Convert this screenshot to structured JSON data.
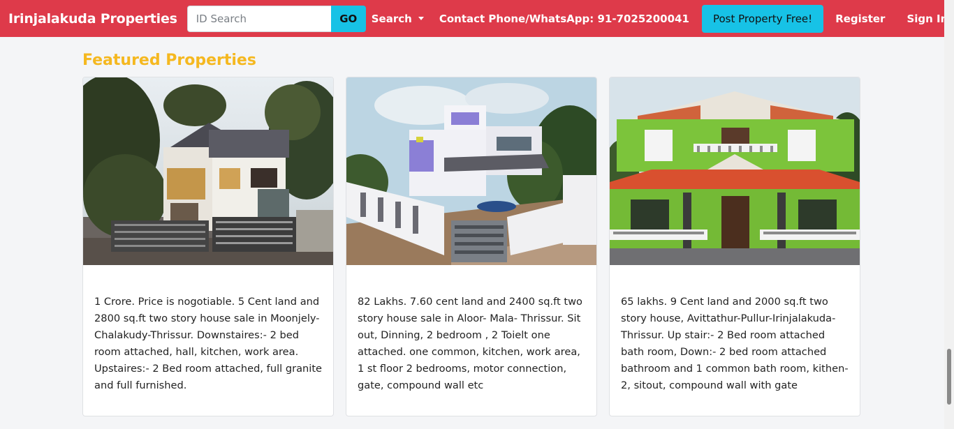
{
  "navbar": {
    "brand": "Irinjalakuda Properties",
    "search_placeholder": "ID Search",
    "search_value": "",
    "go_label": "GO",
    "search_menu_label": "Search",
    "contact_label": "Contact Phone/WhatsApp: 91-7025200041",
    "post_property_label": "Post Property Free!",
    "register_label": "Register",
    "signin_label": "Sign In"
  },
  "section_title": "Featured Properties",
  "properties": [
    {
      "description": "1 Crore. Price is nogotiable. 5 Cent land and 2800 sq.ft two story house sale in Moonjely-Chalakudy-Thrissur. Downstaires:- 2 bed room attached, hall, kitchen, work area. Upstaires:- 2 Bed room attached, full granite and full furnished."
    },
    {
      "description": "82 Lakhs. 7.60 cent land and 2400 sq.ft two story house sale in Aloor- Mala- Thrissur. Sit out, Dinning, 2 bedroom , 2 Toielt one attached. one common, kitchen, work area, 1 st floor 2 bedrooms, motor connection, gate, compound wall etc"
    },
    {
      "description": "65 lakhs. 9 Cent land and 2000 sq.ft two story house, Avittathur-Pullur-Irinjalakuda-Thrissur. Up stair:- 2 Bed room attached bath room, Down:- 2 bed room attached bathroom and 1 common bath room, kithen-2, sitout, compound wall with gate"
    }
  ],
  "colors": {
    "navbar": "#de3a4a",
    "accent_button": "#17c2e6",
    "section_title": "#f5b820"
  }
}
